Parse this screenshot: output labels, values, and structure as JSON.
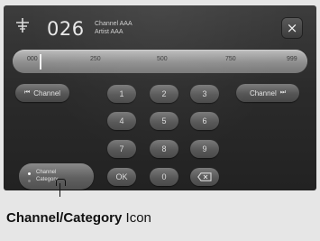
{
  "header": {
    "channel_number": "026",
    "channel_name": "Channel AAA",
    "artist_name": "Artist AAA",
    "close_label": "×",
    "icon": "antenna-icon"
  },
  "slider": {
    "ticks": [
      "000",
      "250",
      "500",
      "750",
      "999"
    ],
    "position_value": 26
  },
  "buttons": {
    "channel_down_label": "Channel",
    "channel_down_icon": "⏮",
    "channel_up_label": "Channel",
    "channel_up_icon": "⏭",
    "keypad": [
      "1",
      "2",
      "3",
      "4",
      "5",
      "6",
      "7",
      "8",
      "9"
    ],
    "ok_label": "OK",
    "zero_label": "0",
    "backspace_icon": "backspace-icon"
  },
  "category_button": {
    "line1": "Channel",
    "line2": "Category"
  },
  "caption": {
    "bold": "Channel/Category",
    "normal": " Icon"
  },
  "colors": {
    "screen_bg": "#2b2b2b",
    "button": "#5a5a5a",
    "slider": "#9a9a9a",
    "active_dot": "#ffffff",
    "inactive_dot": "#8a8a8a"
  }
}
